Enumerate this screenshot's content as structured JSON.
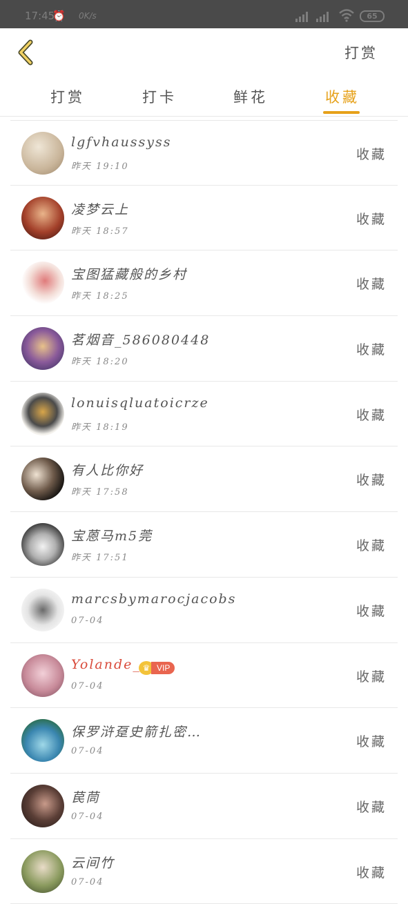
{
  "status_bar": {
    "time": "17:45",
    "speed": "0K/s",
    "battery": "65"
  },
  "nav": {
    "right_action": "打赏"
  },
  "tabs": [
    {
      "label": "打赏",
      "active": false
    },
    {
      "label": "打卡",
      "active": false
    },
    {
      "label": "鲜花",
      "active": false
    },
    {
      "label": "收藏",
      "active": true
    }
  ],
  "items": [
    {
      "name": "lgfvhaussyss",
      "time": "昨天 19:10",
      "action": "收藏",
      "avatar_color": "#d9cbb5"
    },
    {
      "name": "凌梦云上",
      "time": "昨天 18:57",
      "action": "收藏",
      "avatar_color": "#7a2a1e"
    },
    {
      "name": "宝图猛藏般的乡村",
      "time": "昨天 18:25",
      "action": "收藏",
      "avatar_color": "#f4e6e2"
    },
    {
      "name": "茗烟音_586080448",
      "time": "昨天 18:20",
      "action": "收藏",
      "avatar_color": "#5a4a7a"
    },
    {
      "name": "lonuisqluatoicrze",
      "time": "昨天 18:19",
      "action": "收藏",
      "avatar_color": "#f0ede6"
    },
    {
      "name": "有人比你好",
      "time": "昨天 17:58",
      "action": "收藏",
      "avatar_color": "#2a2622"
    },
    {
      "name": "宝蒽马m5莞",
      "time": "昨天 17:51",
      "action": "收藏",
      "avatar_color": "#8c8c8c"
    },
    {
      "name": "marcsbymarocjacobs",
      "time": "07-04",
      "action": "收藏",
      "avatar_color": "#cfcfcf"
    },
    {
      "name": "Yolande_",
      "time": "07-04",
      "action": "收藏",
      "avatar_color": "#c88b9a",
      "vip": true,
      "vip_label": "VIP"
    },
    {
      "name": "保罗浒趸史箭扎密…",
      "time": "07-04",
      "action": "收藏",
      "avatar_color": "#3a86b0"
    },
    {
      "name": "苠茼",
      "time": "07-04",
      "action": "收藏",
      "avatar_color": "#3b2e2a"
    },
    {
      "name": "云间竹",
      "time": "07-04",
      "action": "收藏",
      "avatar_color": "#8a9a5e"
    }
  ]
}
